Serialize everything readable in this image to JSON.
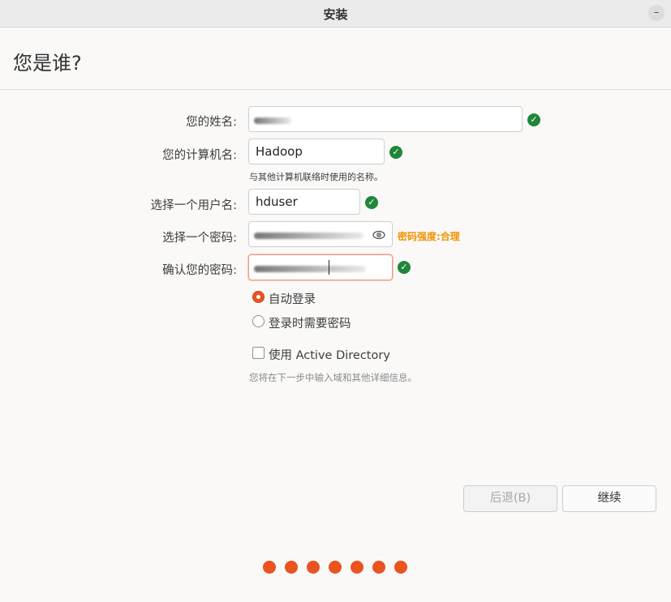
{
  "window": {
    "title": "安装",
    "minimize_icon": "minimize-icon"
  },
  "page": {
    "title": "您是谁?"
  },
  "form": {
    "name_label": "您的姓名:",
    "name_value": "",
    "computer_label": "您的计算机名:",
    "computer_value": "Hadoop",
    "computer_hint": "与其他计算机联络时使用的名称。",
    "username_label": "选择一个用户名:",
    "username_value": "hduser",
    "password_label": "选择一个密码:",
    "password_strength": "密码强度:合理",
    "confirm_label": "确认您的密码:",
    "valid_icon": "check-circle-icon",
    "show_password_icon": "eye-icon"
  },
  "login_options": {
    "auto_login": "自动登录",
    "require_password": "登录时需要密码",
    "selected": "auto_login"
  },
  "active_directory": {
    "label": "使用 Active Directory",
    "checked": false,
    "note": "您将在下一步中输入域和其他详细信息。"
  },
  "buttons": {
    "back": "后退(B)",
    "continue": "继续"
  },
  "progress": {
    "steps": 7,
    "accent": "#e95420"
  },
  "colors": {
    "valid": "#20863a",
    "accent": "#e95420",
    "strength": "#f39200"
  }
}
